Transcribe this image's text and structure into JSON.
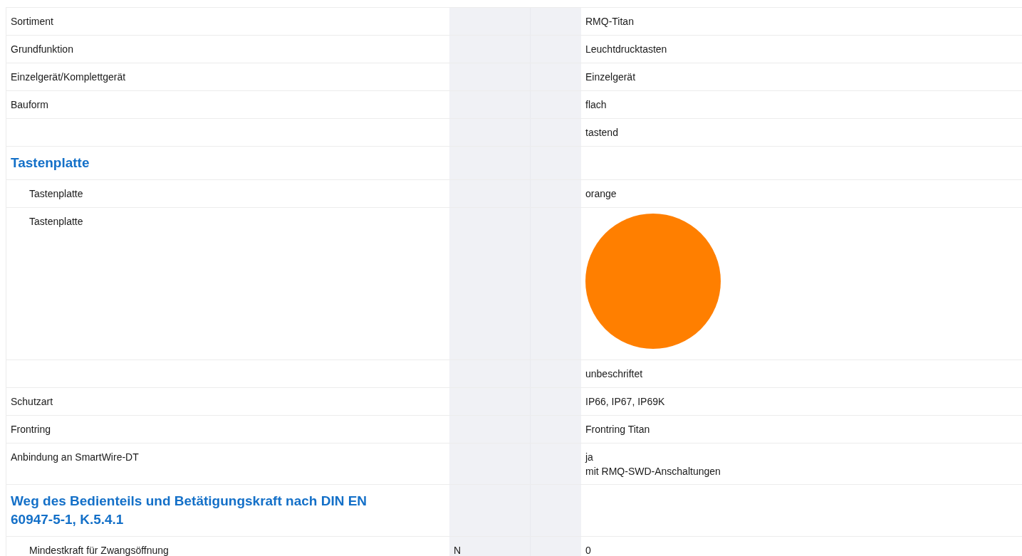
{
  "items": [
    {
      "kind": "property",
      "label": "Sortiment",
      "values": [
        "RMQ-Titan"
      ]
    },
    {
      "kind": "property",
      "label": "Grundfunktion",
      "values": [
        "Leuchtdrucktasten"
      ]
    },
    {
      "kind": "property",
      "label": "Einzelgerät/Komplettgerät",
      "values": [
        "Einzelgerät"
      ]
    },
    {
      "kind": "property",
      "label": "Bauform",
      "values": [
        "flach"
      ]
    },
    {
      "kind": "property",
      "values": [
        "tastend"
      ]
    },
    {
      "kind": "heading",
      "label": "Tastenplatte",
      "children": [
        {
          "kind": "property",
          "label": "Tastenplatte",
          "values": [
            "orange"
          ]
        },
        {
          "kind": "swatch",
          "label": "Tastenplatte",
          "color": "#ff7f00"
        }
      ]
    },
    {
      "kind": "property",
      "values": [
        "unbeschriftet"
      ]
    },
    {
      "kind": "property",
      "label": "Schutzart",
      "values": [
        "IP66, IP67, IP69K"
      ]
    },
    {
      "kind": "property",
      "label": "Frontring",
      "values": [
        "Frontring Titan"
      ]
    },
    {
      "kind": "property",
      "label": "Anbindung an SmartWire-DT",
      "values": [
        "ja",
        "mit RMQ-SWD-Anschaltungen"
      ]
    },
    {
      "kind": "heading",
      "label": "Weg des Bedienteils und Betätigungskraft nach DIN EN 60947-5-1, K.5.4.1",
      "children": [
        {
          "kind": "property",
          "label": "Mindestkraft für Zwangsöffnung",
          "unit": "N",
          "values": [
            "0"
          ]
        }
      ]
    }
  ]
}
